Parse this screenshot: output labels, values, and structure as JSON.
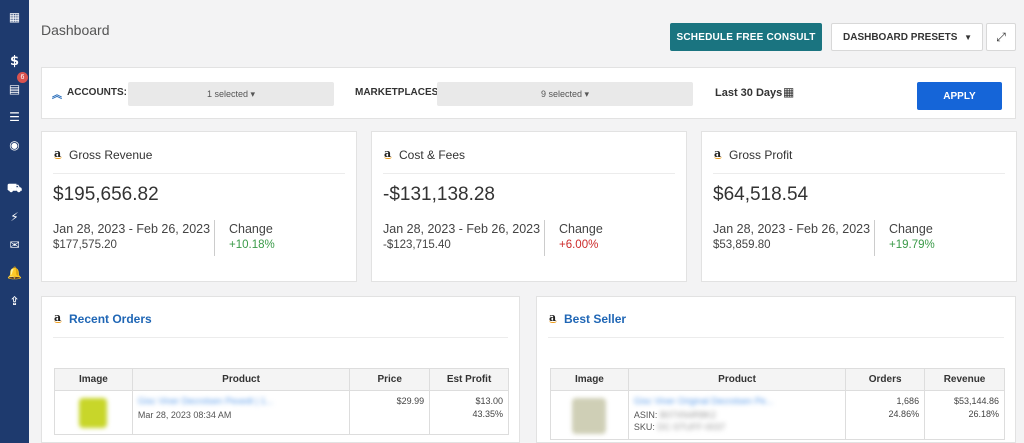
{
  "sidebar": {
    "icons": [
      "grid-icon",
      "dollar-icon",
      "orders-icon",
      "list-icon",
      "target-icon",
      "truck-icon",
      "bolt-icon",
      "envelope-icon",
      "bell-icon",
      "upload-icon"
    ],
    "badge": "6"
  },
  "header": {
    "title": "Dashboard",
    "consult_label": "SCHEDULE FREE CONSULT",
    "presets_label": "DASHBOARD PRESETS"
  },
  "filters": {
    "accounts_label": "ACCOUNTS:",
    "accounts_value": "1 selected ▾",
    "marketplaces_label": "MARKETPLACES:",
    "marketplaces_value": "9 selected ▾",
    "range_label": "Last 30 Days",
    "apply_label": "APPLY"
  },
  "cards": [
    {
      "title": "Gross Revenue",
      "value": "$195,656.82",
      "range": "Jan 28, 2023 - Feb 26, 2023",
      "prev": "$177,575.20",
      "change_label": "Change",
      "change": "+10.18%",
      "change_dir": "pos"
    },
    {
      "title": "Cost & Fees",
      "value": "-$131,138.28",
      "range": "Jan 28, 2023 - Feb 26, 2023",
      "prev": "-$123,715.40",
      "change_label": "Change",
      "change": "+6.00%",
      "change_dir": "neg"
    },
    {
      "title": "Gross Profit",
      "value": "$64,518.54",
      "range": "Jan 28, 2023 - Feb 26, 2023",
      "prev": "$53,859.80",
      "change_label": "Change",
      "change": "+19.79%",
      "change_dir": "pos"
    }
  ],
  "recent_orders": {
    "title": "Recent Orders",
    "columns": [
      "Image",
      "Product",
      "Price",
      "Est Profit"
    ],
    "rows": [
      {
        "product": "Gisc Viner Decrotsen Pexedt | 1...",
        "date": "Mar 28, 2023 08:34 AM",
        "price": "$29.99",
        "profit": "$13.00",
        "margin": "43.35%"
      }
    ]
  },
  "best_seller": {
    "title": "Best Seller",
    "columns": [
      "Image",
      "Product",
      "Orders",
      "Revenue"
    ],
    "rows": [
      {
        "product": "Gisc Viner Original Decrotsen Pe...",
        "asin_label": "ASIN:",
        "asin": "B07XN4R8K2",
        "sku_label": "SKU:",
        "sku": "DC-STUFF-0037",
        "orders": "1,686",
        "orders_pct": "24.86%",
        "revenue": "$53,144.86",
        "revenue_pct": "26.18%"
      }
    ]
  },
  "colors": {
    "sidebar": "#1e3a6e",
    "consult": "#1a7480",
    "apply": "#1565d8",
    "positive": "#3a9a48",
    "negative": "#cc2a2a",
    "link": "#1f66b5"
  }
}
